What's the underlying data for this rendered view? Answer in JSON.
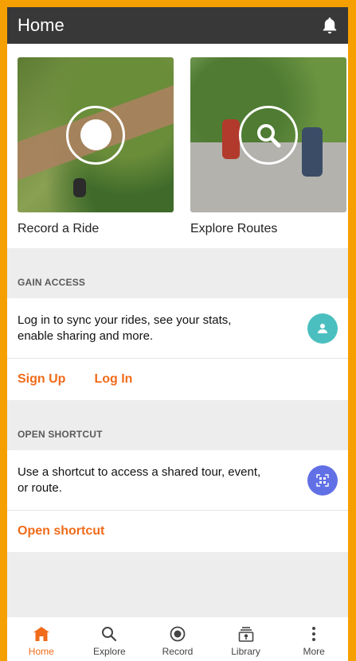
{
  "header": {
    "title": "Home"
  },
  "tiles": [
    {
      "label": "Record a Ride"
    },
    {
      "label": "Explore Routes"
    }
  ],
  "gain_access": {
    "heading": "GAIN ACCESS",
    "message": "Log in to sync your rides, see your stats, enable sharing and more.",
    "sign_up": "Sign Up",
    "log_in": "Log In"
  },
  "open_shortcut": {
    "heading": "OPEN SHORTCUT",
    "message": "Use a shortcut to access a shared tour, event, or route.",
    "action": "Open shortcut"
  },
  "tabbar": {
    "tabs": [
      {
        "label": "Home",
        "icon": "home-icon"
      },
      {
        "label": "Explore",
        "icon": "search-icon"
      },
      {
        "label": "Record",
        "icon": "record-icon"
      },
      {
        "label": "Library",
        "icon": "library-icon"
      },
      {
        "label": "More",
        "icon": "more-icon"
      }
    ]
  },
  "colors": {
    "accent": "#f06b1a",
    "appbar": "#383838",
    "profile_badge": "#4bbfbf",
    "shortcut_badge": "#6270e6",
    "frame": "#f5a000"
  }
}
